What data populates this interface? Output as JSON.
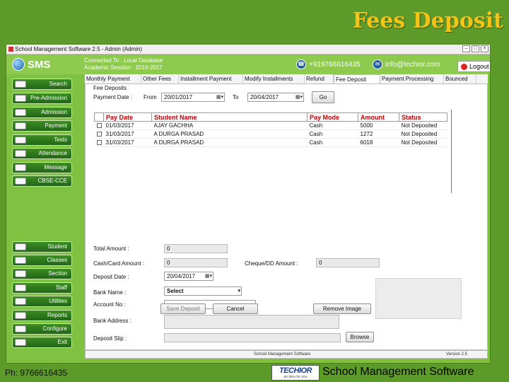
{
  "slide": {
    "title": "Fees Deposit",
    "footer_phone": "Ph: 9766616435",
    "footer_logo": "TECHIOR",
    "footer_logo_tagline": "an idea for you",
    "footer_name": "School Management Software"
  },
  "window": {
    "title": "School Management Software 2.5  -  Admin (Admin)",
    "controls": {
      "minimize": "–",
      "maximize": "□",
      "close": "×"
    }
  },
  "header": {
    "logo": "SMS",
    "connected": "Connected To : Local Database",
    "session": "Academic Session : 2016-2017",
    "phone": "+919766616435",
    "email": "info@techior.com",
    "logout": "Logout"
  },
  "sidebar": {
    "top": [
      "Search",
      "Pre-Admission",
      "Admission",
      "Payment",
      "Tests",
      "Attendance",
      "Message",
      "CBSE-CCE"
    ],
    "bottom": [
      "Student",
      "Classes",
      "Section",
      "Staff",
      "Utilities",
      "Reports",
      "Configure",
      "Exit"
    ]
  },
  "tabs": [
    "Monthly Payment",
    "Other Fees",
    "Installment Payment",
    "Modify Installments",
    "Refund",
    "Fee Deposit",
    "Payment Processing",
    "Bounced"
  ],
  "form": {
    "section": "Fee Deposits",
    "payment_date_label": "Payment Date :",
    "from_label": "From",
    "from_value": "20/01/2017",
    "to_label": "To",
    "to_value": "20/04/2017",
    "go": "Go",
    "total_amount_label": "Total Amount :",
    "total_amount": "0",
    "cash_label": "Cash/Card Amount :",
    "cash_amount": "0",
    "cheque_label": "Cheque/DD Amount :",
    "cheque_amount": "0",
    "deposit_date_label": "Deposit Date :",
    "deposit_date": "20/04/2017",
    "bank_name_label": "Bank Name :",
    "bank_name": "Select",
    "account_no_label": "Account No :",
    "bank_address_label": "Bank Address :",
    "deposit_slip_label": "Deposit Slip :",
    "browse": "Browse",
    "save": "Save Deposit",
    "cancel": "Cancel",
    "remove_image": "Remove Image"
  },
  "table": {
    "columns": [
      "Pay Date",
      "Student Name",
      "Pay Mode",
      "Amount",
      "Status"
    ],
    "rows": [
      [
        "01/03/2017",
        "AJAY GACHHA",
        "Cash",
        "5000",
        "Not Deposited"
      ],
      [
        "31/03/2017",
        "A DURGA PRASAD",
        "Cash",
        "1272",
        "Not Deposited"
      ],
      [
        "31/03/2017",
        "A DURGA PRASAD",
        "Cash",
        "6018",
        "Not Deposited"
      ]
    ]
  },
  "status_bar": {
    "center": "School Management Software",
    "right": "Version 2.5"
  }
}
